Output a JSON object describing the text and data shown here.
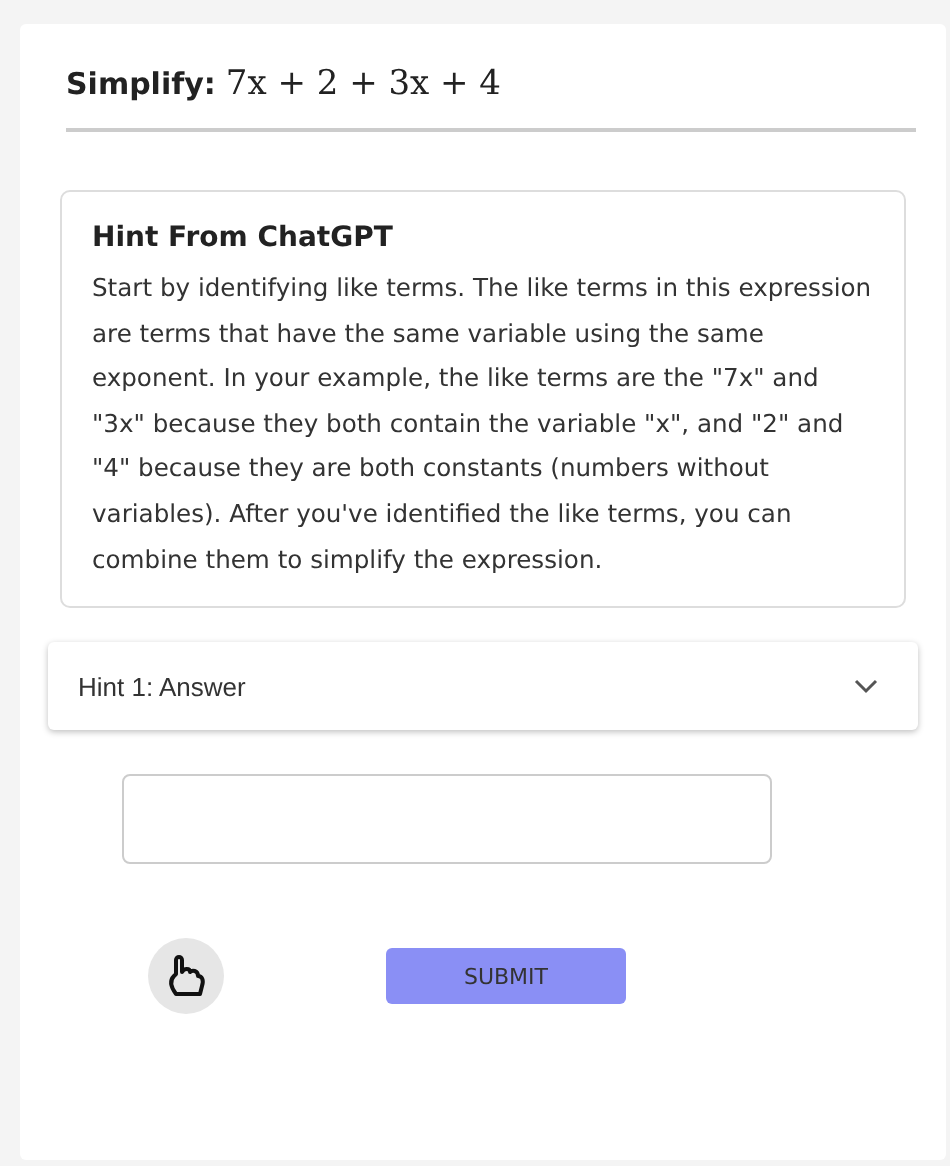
{
  "problem": {
    "label": "Simplify:",
    "expression": "7x + 2 + 3x + 4"
  },
  "hint_card": {
    "title": "Hint From ChatGPT",
    "body": "Start by identifying like terms. The like terms in this expression are terms that have the same variable using the same exponent. In your example, the like terms are the \"7x\" and \"3x\" because they both contain the variable \"x\", and \"2\" and \"4\" because they are both constants (numbers without variables). After you've identified the like terms, you can combine them to simplify the expression."
  },
  "accordion": {
    "label": "Hint 1: Answer",
    "expanded": false
  },
  "submit": {
    "label": "SUBMIT"
  }
}
